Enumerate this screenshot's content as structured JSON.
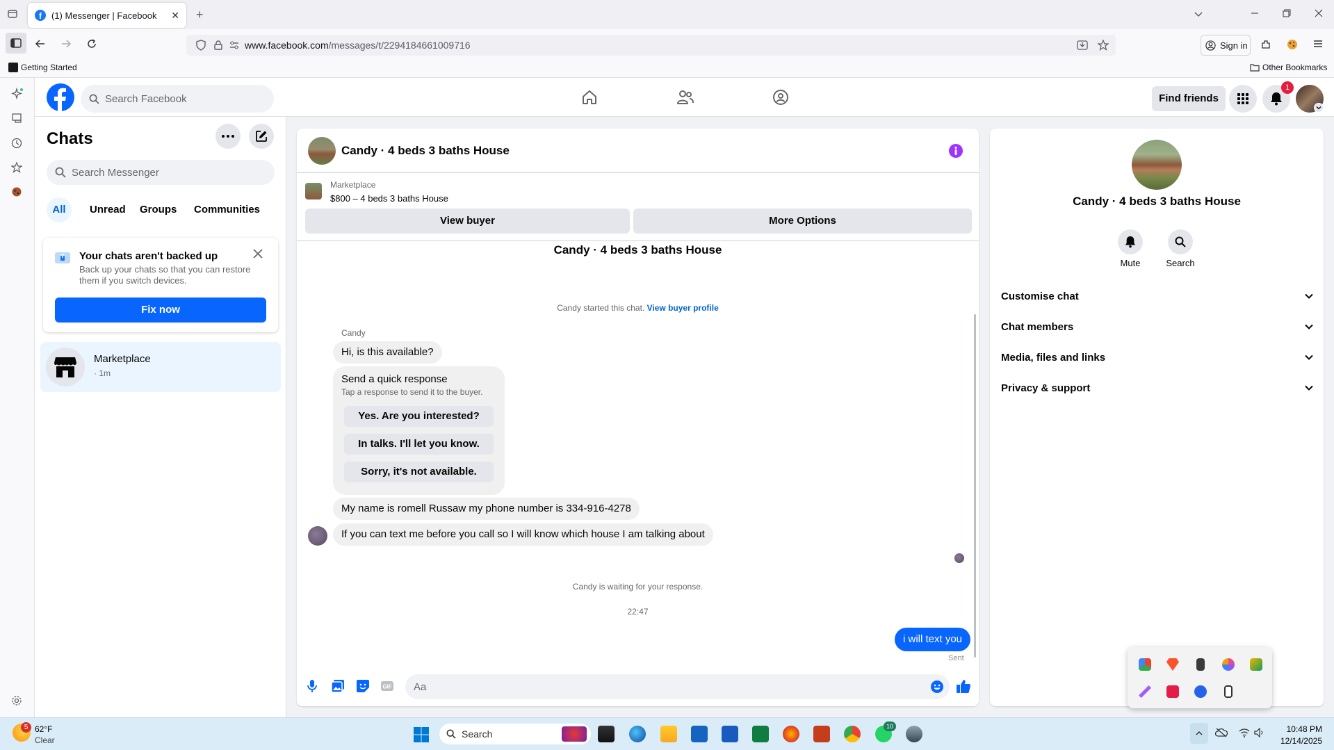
{
  "browser": {
    "tab_title": "(1) Messenger | Facebook",
    "url_domain": "www.facebook.com",
    "url_path": "/messages/t/2294184661009716",
    "sign_in": "Sign in",
    "bookmark_getting_started": "Getting Started",
    "bookmark_other": "Other Bookmarks"
  },
  "fb_header": {
    "search_placeholder": "Search Facebook",
    "find_friends": "Find friends",
    "notification_count": "1"
  },
  "chats": {
    "title": "Chats",
    "search_placeholder": "Search Messenger",
    "filters": [
      "All",
      "Unread",
      "Groups",
      "Communities"
    ],
    "backup_title": "Your chats aren't backed up",
    "backup_text": "Back up your chats so that you can restore them if you switch devices.",
    "fix_now": "Fix now",
    "item_name": "Marketplace",
    "item_time": "· 1m"
  },
  "conversation": {
    "title": "Candy · 4 beds 3 baths House",
    "listing_source": "Marketplace",
    "listing_text": "$800 – 4 beds 3 baths House",
    "view_buyer": "View buyer",
    "more_options": "More Options",
    "top_name": "Candy · 4 beds 3 baths House",
    "started_text": "Candy started this chat.",
    "view_buyer_profile": "View buyer profile",
    "sender_name": "Candy",
    "msg1": "Hi, is this available?",
    "quick_title": "Send a quick response",
    "quick_sub": "Tap a response to send it to the buyer.",
    "quick_replies": [
      "Yes. Are you interested?",
      "In talks. I'll let you know.",
      "Sorry, it's not available."
    ],
    "msg2": "My name is romell Russaw my phone number is 334-916-4278",
    "msg3": "If you can text me before you call so I will know which house I am talking about",
    "waiting": "Candy is waiting for your response.",
    "time": "22:47",
    "my_msg": "i will text you",
    "sent": "Sent",
    "composer_placeholder": "Aa"
  },
  "info_panel": {
    "name": "Candy · 4 beds 3 baths House",
    "mute": "Mute",
    "search": "Search",
    "sections": [
      "Customise chat",
      "Chat members",
      "Media, files and links",
      "Privacy & support"
    ]
  },
  "taskbar": {
    "weather_temp": "62°F",
    "weather_desc": "Clear",
    "weather_badge": "5",
    "search": "Search",
    "whatsapp_badge": "10",
    "clock_time": "10:48 PM",
    "clock_date": "12/14/2025"
  },
  "colors": {
    "fb_blue": "#0866ff",
    "accent_purple": "#a033ff",
    "bubble_grey": "#f0f0f0",
    "selected_chat": "#ebf5ff"
  }
}
